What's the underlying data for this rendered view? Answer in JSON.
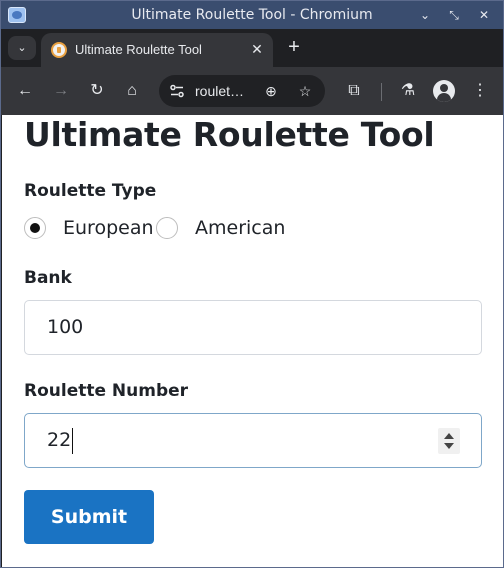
{
  "window": {
    "title": "Ultimate Roulette Tool - Chromium",
    "minimize_glyph": "⌄",
    "restore_glyph": "⤡",
    "close_glyph": "✕"
  },
  "tabs": [
    {
      "title": "Ultimate Roulette Tool",
      "active": true
    }
  ],
  "tabstrip": {
    "menu_glyph": "⌄",
    "new_tab_glyph": "+"
  },
  "toolbar": {
    "url": "roulet…",
    "back_glyph": "←",
    "forward_glyph": "→",
    "reload_glyph": "↻",
    "home_glyph": "⌂",
    "zoom_glyph": "⊕",
    "bookmark_glyph": "☆",
    "extensions_glyph": "⧉",
    "labs_glyph": "⚗",
    "menu_glyph": "⋮"
  },
  "page": {
    "heading": "Ultimate Roulette Tool",
    "roulette_type": {
      "label": "Roulette Type",
      "options": [
        {
          "label": "European",
          "checked": true
        },
        {
          "label": "American",
          "checked": false
        }
      ]
    },
    "bank": {
      "label": "Bank",
      "value": "100"
    },
    "roulette_number": {
      "label": "Roulette Number",
      "value": "22"
    },
    "submit_label": "Submit"
  },
  "colors": {
    "titlebar_bg": "#3a4d6f",
    "tab_bg": "#35363a",
    "button_primary": "#1a73c3",
    "focus_border": "#7fa7c9"
  }
}
